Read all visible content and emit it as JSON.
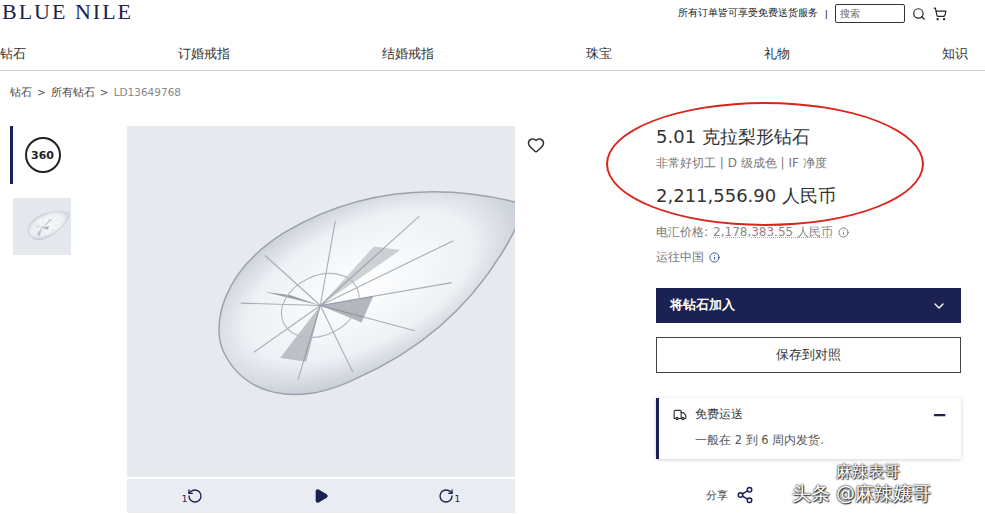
{
  "header": {
    "logo": "BLUE NILE",
    "promo": "所有订单皆可享受免费送货服务",
    "separator": "|",
    "search": {
      "placeholder": "搜索"
    }
  },
  "nav": [
    "钻石",
    "订婚戒指",
    "结婚戒指",
    "珠宝",
    "礼物",
    "知识"
  ],
  "breadcrumb": {
    "items": [
      "钻石",
      "所有钻石",
      "LD13649768"
    ],
    "separator": ">"
  },
  "thumbnails": [
    {
      "kind": "360",
      "label": "360",
      "selected": true
    },
    {
      "kind": "image",
      "selected": false
    }
  ],
  "viewer": {
    "favorite": false,
    "controls": [
      {
        "kind": "rotate-left",
        "label": "1"
      },
      {
        "kind": "play"
      },
      {
        "kind": "rotate-right",
        "label": "1"
      }
    ]
  },
  "product": {
    "title": "5.01 克拉梨形钻石",
    "specs": "非常好切工 | D 级成色 | IF 净度",
    "price": "2,211,556.90 人民币",
    "wire_price": {
      "label": "电汇价格:",
      "value": "2,178,383.55 人民币"
    },
    "ship_to": "运往中国"
  },
  "buttons": {
    "add": "将钻石加入",
    "compare": "保存到对照"
  },
  "shipping": {
    "title": "免费运送",
    "detail": "一般在 2 到 6 周内发货.",
    "toggle": "−",
    "expanded": true
  },
  "share": "分享",
  "watermarks": [
    "麻辣表哥",
    "头条 @麻辣嬢哥"
  ]
}
